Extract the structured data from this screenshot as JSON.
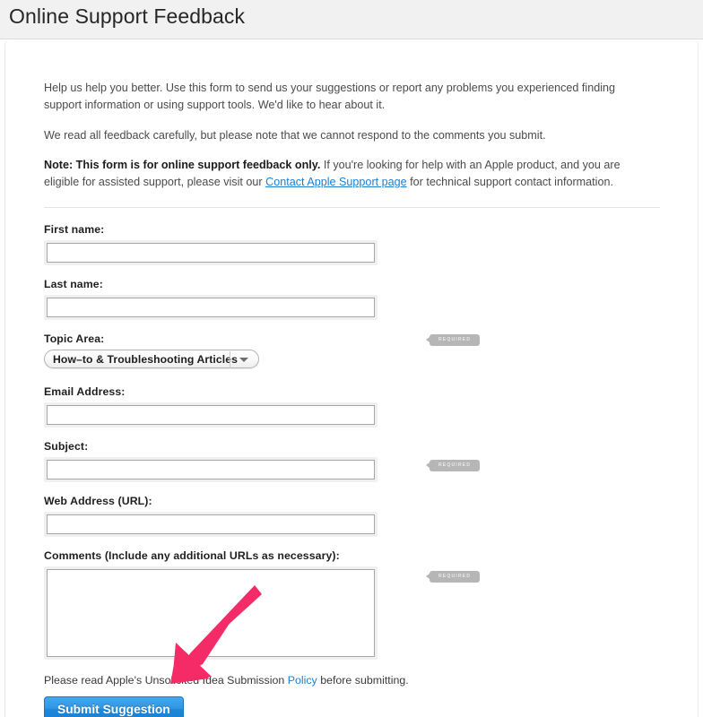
{
  "window": {
    "title": "Online Support Feedback"
  },
  "intro": {
    "paragraph_1": "Help us help you better. Use this form to send us your suggestions or report any problems you experienced finding support information or using support tools. We'd like to hear about it.",
    "paragraph_2": "We read all feedback carefully, but please note that we cannot respond to the comments you submit.",
    "note_bold": "Note: This form is for online support feedback only.",
    "note_before_link": " If you're looking for help with an Apple product, and you are eligible for assisted support, please visit our ",
    "note_link": "Contact Apple Support page",
    "note_after_link": " for technical support contact information."
  },
  "form": {
    "first_name": {
      "label": "First name:",
      "value": "",
      "placeholder": ""
    },
    "last_name": {
      "label": "Last name:",
      "value": "",
      "placeholder": ""
    },
    "topic_area": {
      "label": "Topic Area:",
      "selected": "How–to & Troubleshooting Articles",
      "required_badge": "REQUIRED"
    },
    "email_address": {
      "label": "Email Address:",
      "value": "",
      "placeholder": ""
    },
    "subject": {
      "label": "Subject:",
      "value": "",
      "placeholder": "",
      "required_badge": "REQUIRED"
    },
    "web_address": {
      "label": "Web Address (URL):",
      "value": "",
      "placeholder": ""
    },
    "comments": {
      "label": "Comments (Include any additional URLs as necessary):",
      "value": "",
      "placeholder": "",
      "required_badge": "REQUIRED"
    }
  },
  "footer": {
    "policy_before_link": "Please read Apple's Unsolicited Idea Submission ",
    "policy_link": "Policy",
    "policy_after_link": " before submitting.",
    "submit_label": "Submit Suggestion"
  },
  "annotation": {
    "arrow_color": "#F42B67",
    "points_to": "submit-suggestion-button"
  },
  "colors": {
    "header_background": "#F1F1F1",
    "link": "#1B7FD4",
    "submit_button": "#2F96E2",
    "required_badge": "#B6B6B6",
    "arrow_pink": "#F42B67"
  }
}
